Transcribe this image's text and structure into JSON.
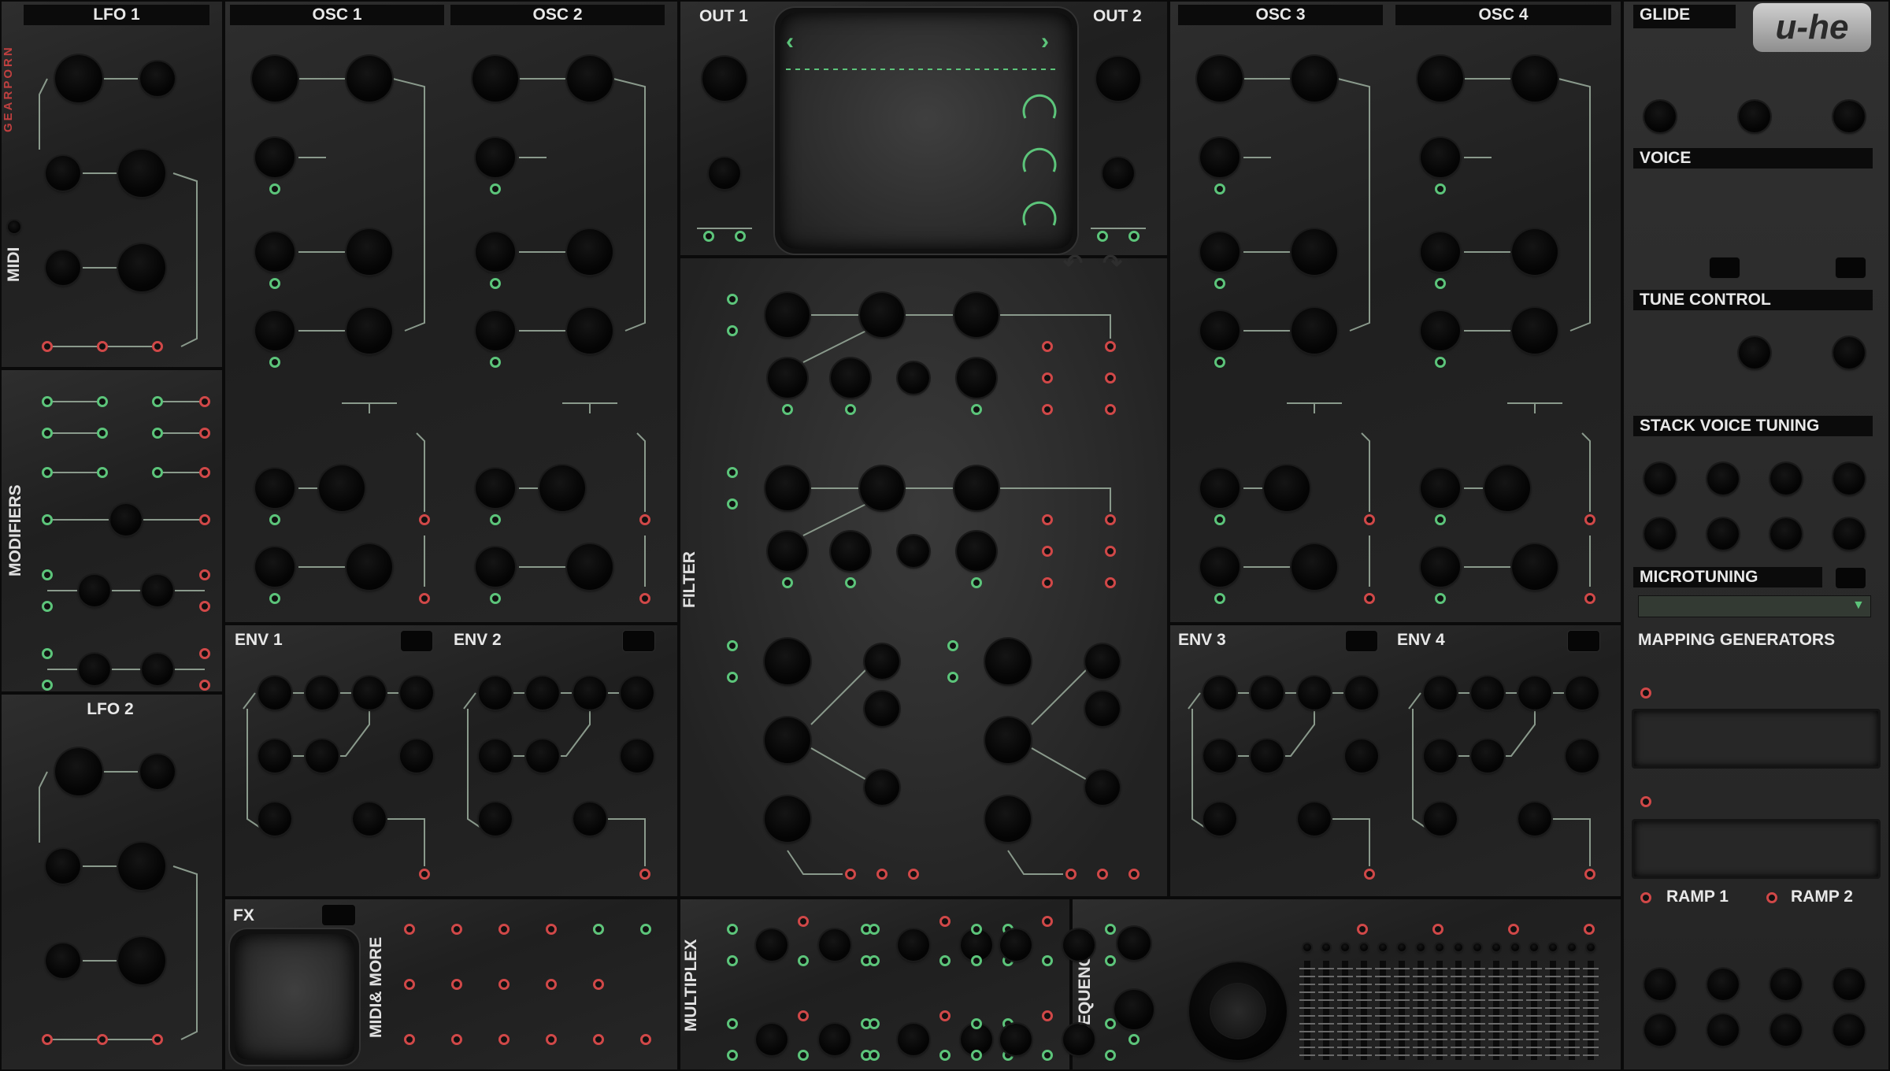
{
  "app": {
    "brand_logo": "u-he",
    "side_tag": "GEARPORN"
  },
  "panels": {
    "lfo1": "LFO 1",
    "lfo2": "LFO 2",
    "midi": "MIDI",
    "modifiers": "MODIFIERS",
    "osc1": "OSC 1",
    "osc2": "OSC 2",
    "osc3": "OSC 3",
    "osc4": "OSC 4",
    "out1": "OUT 1",
    "out2": "OUT 2",
    "filter": "FILTER",
    "env1": "ENV 1",
    "env2": "ENV 2",
    "env3": "ENV 3",
    "env4": "ENV 4",
    "fx": "FX",
    "midi_more": "MIDI& MORE",
    "multiplex": "MULTIPLEX",
    "sequencer": "SEQUENCER"
  },
  "right": {
    "glide": "GLIDE",
    "voice": "VOICE",
    "tune_control": "TUNE CONTROL",
    "stack_voice_tuning": "STACK VOICE TUNING",
    "microtuning": "MICROTUNING",
    "mapping_generators": "MAPPING GENERATORS",
    "ramp1": "RAMP 1",
    "ramp2": "RAMP 2"
  },
  "scope": {
    "prev_icon": "chevron-left-icon",
    "next_icon": "chevron-right-icon",
    "undo_icon": "undo-icon",
    "redo_icon": "redo-icon"
  },
  "colors": {
    "jack_green": "#5cc47a",
    "jack_red": "#d04848",
    "panel_dark": "#1f1f1f",
    "label_bar": "#0b0b0b"
  }
}
